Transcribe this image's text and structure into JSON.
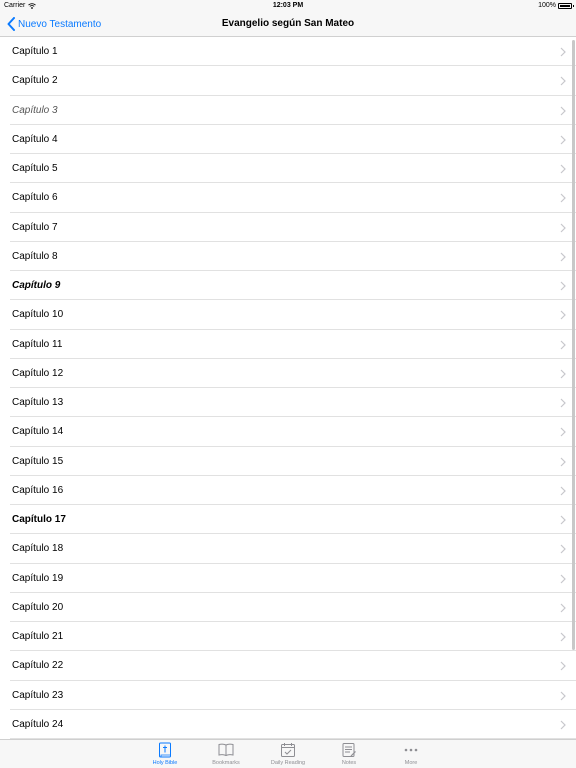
{
  "status": {
    "carrier": "Carrier",
    "time": "12:03 PM",
    "battery": "100%",
    "battery_level": 1.0
  },
  "nav": {
    "back_label": "Nuevo Testamento",
    "title": "Evangelio según San Mateo"
  },
  "chapters": [
    {
      "label": "Capítulo 1",
      "style": "normal"
    },
    {
      "label": "Capítulo 2",
      "style": "normal"
    },
    {
      "label": "Capítulo 3",
      "style": "italic"
    },
    {
      "label": "Capítulo 4",
      "style": "normal"
    },
    {
      "label": "Capítulo 5",
      "style": "normal"
    },
    {
      "label": "Capítulo 6",
      "style": "normal"
    },
    {
      "label": "Capítulo 7",
      "style": "normal"
    },
    {
      "label": "Capítulo 8",
      "style": "normal"
    },
    {
      "label": "Capítulo 9",
      "style": "bold-italic"
    },
    {
      "label": "Capítulo 10",
      "style": "normal"
    },
    {
      "label": "Capítulo 11",
      "style": "normal"
    },
    {
      "label": "Capítulo 12",
      "style": "normal"
    },
    {
      "label": "Capítulo 13",
      "style": "normal"
    },
    {
      "label": "Capítulo 14",
      "style": "normal"
    },
    {
      "label": "Capítulo 15",
      "style": "normal"
    },
    {
      "label": "Capítulo 16",
      "style": "normal"
    },
    {
      "label": "Capítulo 17",
      "style": "bold"
    },
    {
      "label": "Capítulo 18",
      "style": "normal"
    },
    {
      "label": "Capítulo 19",
      "style": "normal"
    },
    {
      "label": "Capítulo 20",
      "style": "normal"
    },
    {
      "label": "Capítulo 21",
      "style": "normal"
    },
    {
      "label": "Capítulo 22",
      "style": "normal"
    },
    {
      "label": "Capítulo 23",
      "style": "normal"
    },
    {
      "label": "Capítulo 24",
      "style": "normal"
    }
  ],
  "tabs": [
    {
      "label": "Holy Bible",
      "icon": "bible-icon",
      "active": true
    },
    {
      "label": "Bookmarks",
      "icon": "book-open-icon",
      "active": false
    },
    {
      "label": "Daily Reading",
      "icon": "calendar-check-icon",
      "active": false
    },
    {
      "label": "Notes",
      "icon": "notes-icon",
      "active": false
    },
    {
      "label": "More",
      "icon": "more-dots-icon",
      "active": false
    }
  ],
  "colors": {
    "accent": "#0a7aff",
    "inactive": "#8e8e93",
    "bar_bg": "#f7f7f7",
    "separator": "#e1e1e1"
  }
}
